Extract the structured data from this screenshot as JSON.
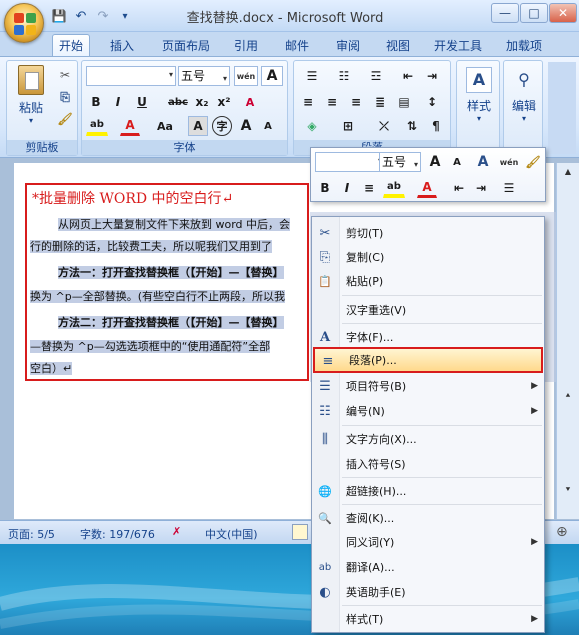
{
  "window": {
    "title": "查找替换.docx - Microsoft Word"
  },
  "qat": {
    "save": "💾",
    "undo": "↶",
    "redo": "↷",
    "more": "▾"
  },
  "window_buttons": {
    "minimize": "—",
    "maximize": "□",
    "close": "✕"
  },
  "tabs": [
    "开始",
    "插入",
    "页面布局",
    "引用",
    "邮件",
    "审阅",
    "视图",
    "开发工具",
    "加载项"
  ],
  "ribbon": {
    "clipboard": {
      "label": "剪贴板",
      "paste": "粘贴"
    },
    "font": {
      "label": "字体",
      "size": "五号",
      "font_name": "",
      "bold": "B",
      "italic": "I",
      "underline": "U",
      "strike": "abc",
      "sub": "x₂",
      "sup": "x²",
      "clear": "A",
      "highlight": "ab",
      "color": "A",
      "case": "Aa",
      "char_border": "A",
      "char_enclose": "字",
      "grow": "A",
      "shrink": "A",
      "phonetic": "wén",
      "border_char": "A"
    },
    "paragraph": {
      "label": "段落"
    },
    "styles": {
      "label": "样式"
    },
    "editing": {
      "label": "编辑"
    }
  },
  "document": {
    "heading": "*批量删除 WORD 中的空白行↵",
    "lines": [
      "从网页上大量复制文件下来放到 word 中后，会",
      "行的删除的话，比较费工夫，所以呢我们又用到了",
      "方法一：打开查找替换框（【开始】—【替换】",
      "换为 ^p—全部替换。(有些空白行不止两段，所以我",
      "方法二：打开查找替换框（【开始】—【替换】",
      "—替换为 ^p—勾选选项框中的“使用通配符”全部",
      "空白）↵"
    ]
  },
  "minitoolbar": {
    "size": "五号",
    "bold": "B",
    "italic": "I",
    "align": "≡",
    "highlight": "ab",
    "color": "A",
    "wen": "wén",
    "grow": "A",
    "shrink": "A"
  },
  "context_menu": {
    "items": [
      {
        "label": "剪切(T)",
        "icon": "scissors-icon",
        "glyph": "✂"
      },
      {
        "label": "复制(C)",
        "icon": "copy-icon",
        "glyph": "⎘"
      },
      {
        "label": "粘贴(P)",
        "icon": "paste-icon",
        "glyph": "📋"
      },
      {
        "label": "汉字重选(V)",
        "icon": "",
        "glyph": ""
      },
      {
        "label": "字体(F)...",
        "icon": "font-icon",
        "glyph": "A"
      },
      {
        "label": "段落(P)...",
        "icon": "paragraph-icon",
        "glyph": "≡"
      },
      {
        "label": "项目符号(B)",
        "icon": "bullets-icon",
        "glyph": "☰"
      },
      {
        "label": "编号(N)",
        "icon": "numbering-icon",
        "glyph": "☷"
      },
      {
        "label": "文字方向(X)...",
        "icon": "text-direction-icon",
        "glyph": "⫼"
      },
      {
        "label": "插入符号(S)",
        "icon": "",
        "glyph": ""
      },
      {
        "label": "超链接(H)...",
        "icon": "hyperlink-icon",
        "glyph": "🌐"
      },
      {
        "label": "查阅(K)...",
        "icon": "lookup-icon",
        "glyph": "🔍"
      },
      {
        "label": "同义词(Y)",
        "icon": "",
        "glyph": ""
      },
      {
        "label": "翻译(A)...",
        "icon": "translate-icon",
        "glyph": "ab"
      },
      {
        "label": "英语助手(E)",
        "icon": "english-assistant-icon",
        "glyph": "◐"
      },
      {
        "label": "样式(T)",
        "icon": "",
        "glyph": ""
      }
    ]
  },
  "status": {
    "page": "页面: 5/5",
    "words": "字数: 197/676",
    "lang": "中文(中国)"
  },
  "accent": {
    "red": "#d81c1c",
    "selection": "#c2cde4"
  }
}
